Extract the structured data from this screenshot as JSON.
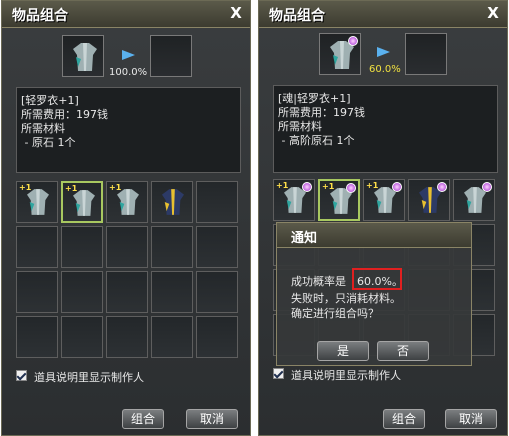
{
  "left_window": {
    "title": "物品组合",
    "close": "X",
    "rate": "100.0%",
    "info": [
      "[轻罗衣+1]",
      "所需费用：197钱",
      "所需材料",
      " - 原石 1个"
    ],
    "grid_items": [
      {
        "plus": "+1",
        "type": "robe",
        "selected": false
      },
      {
        "plus": "+1",
        "type": "robe",
        "selected": true
      },
      {
        "plus": "+1",
        "type": "robe",
        "selected": false
      },
      {
        "plus": "",
        "type": "gold-robe",
        "selected": false
      }
    ],
    "checkbox_label": "道具说明里显示制作人",
    "combine_button": "组合",
    "cancel_button": "取消"
  },
  "right_window": {
    "title": "物品组合",
    "close": "X",
    "rate": "60.0%",
    "info": [
      "[魂|轻罗衣+1]",
      "所需费用：197钱",
      "所需材料",
      " - 高阶原石 1个"
    ],
    "grid_items": [
      {
        "plus": "+1",
        "type": "robe",
        "selected": false
      },
      {
        "plus": "+1",
        "type": "robe",
        "selected": true
      },
      {
        "plus": "+1",
        "type": "robe",
        "selected": false
      },
      {
        "plus": "",
        "type": "gold-robe",
        "selected": false
      },
      {
        "plus": "",
        "type": "robe",
        "selected": false
      }
    ],
    "checkbox_label": "道具说明里显示制作人",
    "combine_button": "组合",
    "cancel_button": "取消"
  },
  "dialog": {
    "title": "通知",
    "line1_prefix": "成功概率是",
    "line1_value": "60.0%。",
    "line2": "失败时，只消耗材料。",
    "line3": "确定进行组合吗？",
    "yes": "是",
    "no": "否"
  },
  "colors": {
    "rate_left": "#e8e8e8",
    "rate_right": "#f0e040",
    "highlight": "#e02020",
    "plus": "#ffe04a"
  }
}
